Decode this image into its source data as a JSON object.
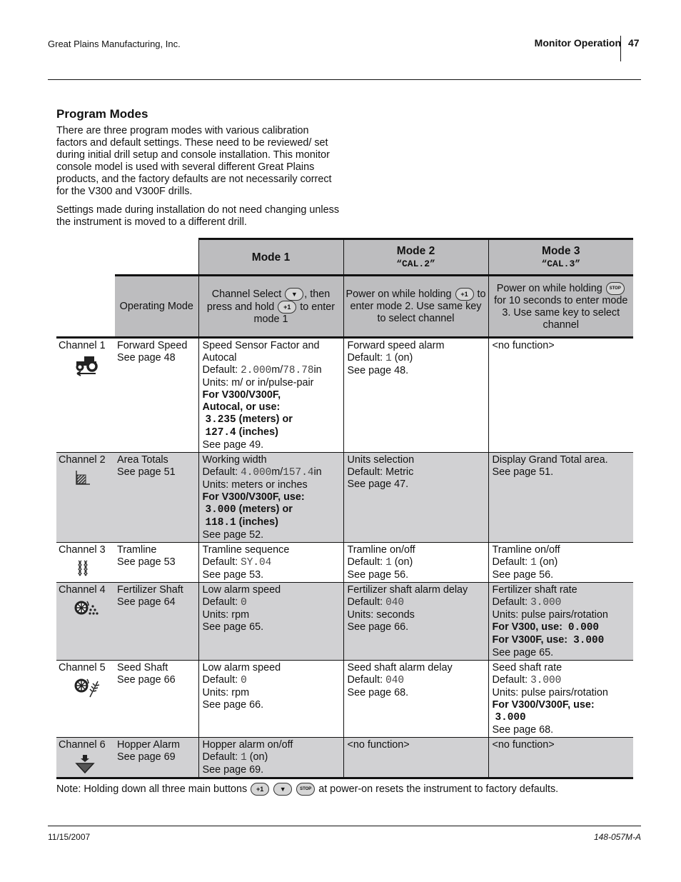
{
  "header": {
    "company": "Great Plains Manufacturing, Inc.",
    "section": "Monitor Operation",
    "page_number": "47"
  },
  "section_title": "Program Modes",
  "intro": [
    "There are three program modes with various calibration factors and default settings. These need to be reviewed/ set during initial drill setup and console installation. This monitor console model is used with several different Great Plains products, and the factory defaults are not necessarily correct for the V300 and V300F drills.",
    "Settings made during installation do not need changing unless the instrument is moved to a different drill."
  ],
  "table": {
    "modes": [
      {
        "title": "Mode 1",
        "code": ""
      },
      {
        "title": "Mode 2",
        "code": "“CAL.2”"
      },
      {
        "title": "Mode 3",
        "code": "“CAL.3”"
      }
    ],
    "operating_mode_label": "Operating Mode",
    "operating": {
      "mode1": {
        "a": "Channel Select",
        "b": ", then press and hold",
        "c": "to enter mode 1"
      },
      "mode2": {
        "a": "Power on while holding",
        "b": "to enter mode 2. Use same key to select channel"
      },
      "mode3": {
        "a": "Power on while holding",
        "b": "for 10 seconds to enter mode 3. Use same key to select channel"
      }
    },
    "keys": {
      "plus1": "+1",
      "select": "▼",
      "stop": "STOP"
    },
    "rows": [
      {
        "channel": "Channel 1",
        "icon": "tractor-icon",
        "function": "Forward Speed",
        "see": "See page 48",
        "mode1": {
          "l1": "Speed Sensor Factor and Autocal",
          "def_label": "Default: ",
          "def1": "2.000",
          "u1": "m/",
          "def2": "78.78",
          "u2": "in",
          "units": "Units: m/ or in/pulse-pair",
          "b1": "For V300/V300F,",
          "b2": "Autocal, or use:",
          "v1": "3.235",
          "v1s": " (meters) or",
          "v2": "127.4",
          "v2s": " (inches)",
          "see": "See page 49."
        },
        "mode2": {
          "l1": "Forward speed alarm",
          "def_label": "Default: ",
          "def": "1",
          "def_s": " (on)",
          "see": "See page 48."
        },
        "mode3": {
          "l1": "<no function>"
        }
      },
      {
        "channel": "Channel 2",
        "icon": "area-icon",
        "function": "Area Totals",
        "see": "See page 51",
        "mode1": {
          "l1": "Working width",
          "def_label": "Default: ",
          "def1": "4.000",
          "u1": "m/",
          "def2": "157.4",
          "u2": "in",
          "units": "Units: meters or inches",
          "b1": "For V300/V300F, use:",
          "v1": "3.000",
          "v1s": " (meters) or",
          "v2": "118.1",
          "v2s": " (inches)",
          "see": "See page 52."
        },
        "mode2": {
          "l1": "Units selection",
          "l2": "Default: Metric",
          "see": "See page 47."
        },
        "mode3": {
          "l1": "Display Grand Total area.",
          "see": "See page 51."
        }
      },
      {
        "channel": "Channel 3",
        "icon": "tramline-icon",
        "function": "Tramline",
        "see": "See page 53",
        "mode1": {
          "l1": "Tramline sequence",
          "def_label": "Default: ",
          "def": "SY.04",
          "see": "See page 53."
        },
        "mode2": {
          "l1": "Tramline on/off",
          "def_label": "Default: ",
          "def": "1",
          "def_s": " (on)",
          "see": "See page 56."
        },
        "mode3": {
          "l1": "Tramline on/off",
          "def_label": "Default: ",
          "def": "1",
          "def_s": " (on)",
          "see": "See page 56."
        }
      },
      {
        "channel": "Channel 4",
        "icon": "fertilizer-shaft-icon",
        "function": "Fertilizer Shaft",
        "see": "See page 64",
        "mode1": {
          "l1": "Low alarm speed",
          "def_label": "Default: ",
          "def": "0",
          "units": "Units: rpm",
          "see": "See page 65."
        },
        "mode2": {
          "l1": "Fertilizer shaft alarm delay",
          "def_label": "Default: ",
          "def": "040",
          "units": "Units: seconds",
          "see": "See page 66."
        },
        "mode3": {
          "l1": "Fertilizer shaft rate",
          "def_label": "Default: ",
          "def": "3.000",
          "units": "Units: pulse pairs/rotation",
          "b1": "For V300, use:",
          "b1v": "0.000",
          "b2": "For V300F, use:",
          "b2v": "3.000",
          "see": "See page 65."
        }
      },
      {
        "channel": "Channel 5",
        "icon": "seed-shaft-icon",
        "function": "Seed Shaft",
        "see": "See page 66",
        "mode1": {
          "l1": "Low alarm speed",
          "def_label": "Default: ",
          "def": "0",
          "units": "Units: rpm",
          "see": "See page 66."
        },
        "mode2": {
          "l1": "Seed shaft alarm delay",
          "def_label": "Default: ",
          "def": "040",
          "see": "See page 68."
        },
        "mode3": {
          "l1": "Seed shaft rate",
          "def_label": "Default: ",
          "def": "3.000",
          "units": "Units: pulse pairs/rotation",
          "b1": "For V300/V300F, use:",
          "v1": "3.000",
          "see": "See page 68."
        }
      },
      {
        "channel": "Channel 6",
        "icon": "hopper-icon",
        "function": "Hopper Alarm",
        "see": "See page 69",
        "mode1": {
          "l1": "Hopper alarm on/off",
          "def_label": "Default: ",
          "def": "1",
          "def_s": " (on)",
          "see": "See page 69."
        },
        "mode2": {
          "l1": "<no function>"
        },
        "mode3": {
          "l1": "<no function>"
        }
      }
    ]
  },
  "note": {
    "a": "Note:  Holding down all three main buttons",
    "b": "at power-on resets the instrument to factory defaults."
  },
  "footer": {
    "date": "11/15/2007",
    "doc_number": "148-057M-A"
  }
}
